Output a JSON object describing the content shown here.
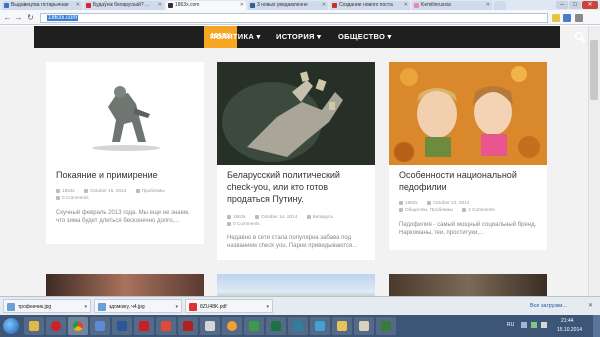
{
  "browser": {
    "tabs": [
      {
        "label": "Выдавецтва гістарычнае",
        "color": "#3b73c4"
      },
      {
        "label": "Будаўнік беларускай? ...",
        "color": "#d23"
      },
      {
        "label": "1863x.com",
        "color": "#333"
      },
      {
        "label": "3 новых уведамленне",
        "color": "#3b5998"
      },
      {
        "label": "Создание нового поста",
        "color": "#c9302c"
      },
      {
        "label": "Kemilinrussia",
        "color": "#e8a"
      }
    ],
    "url": "1863x.com"
  },
  "site": {
    "logo": "1863X",
    "nav": [
      "ПОЛИТИКА ▾",
      "ИСТОРИЯ ▾",
      "ОБЩЕСТВО ▾"
    ]
  },
  "cards": [
    {
      "title": "Покаяние и примирение",
      "author": "1863x",
      "date": "October 15, 2014",
      "category": "Проблемы",
      "comments": "0 Comments",
      "excerpt": "Скучный февраль 2013 года. Мы еще не знаем, что зима будет длиться бесконечно долго,..."
    },
    {
      "title": "Беларусский политический check-you, или кто готов продаться Путину.",
      "author": "1863x",
      "date": "October 14, 2014",
      "category": "Беларусь",
      "comments": "0 Comments",
      "excerpt": "Недавно в сети стала популярна забава под названием check you. Парни привидываются..."
    },
    {
      "title": "Особенности национальной педофилии",
      "author": "1863x",
      "date": "October 13, 2014",
      "category": "Общество, Проблемы",
      "comments": "2 Comments",
      "excerpt": "Педофилия - самый мощный социальный бренд. Наркоманы, геи, проституки,..."
    }
  ],
  "downloads": [
    {
      "name": "трофеичик.jpg"
    },
    {
      "name": "здоможу, ч4.jpg"
    },
    {
      "name": "8ZU48K.pdf"
    }
  ],
  "download_all": "Все загрузки...",
  "tray": {
    "lang": "RU",
    "time": "21:44",
    "date": "15.10.2014"
  }
}
